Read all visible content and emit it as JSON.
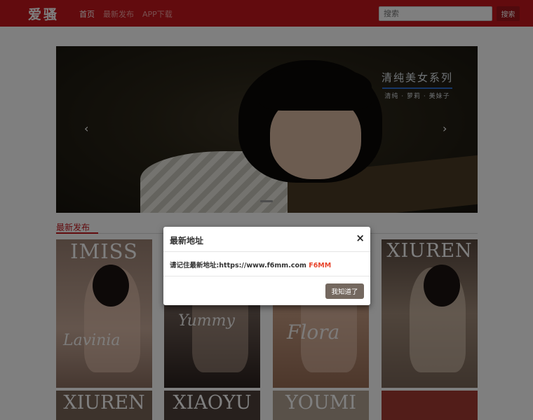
{
  "header": {
    "logo_text": "爱骚",
    "nav": [
      {
        "label": "首页"
      },
      {
        "label": "最新发布"
      },
      {
        "label": "APP下载"
      }
    ],
    "search": {
      "placeholder": "搜索",
      "button_label": "搜索"
    }
  },
  "carousel": {
    "caption_title": "清纯美女系列",
    "caption_sub": "清纯 · 萝莉 · 美妹子",
    "prev_icon": "chevron-left-icon",
    "next_icon": "chevron-right-icon"
  },
  "section": {
    "title": "最新发布"
  },
  "tiles": [
    {
      "brand": "IMISS",
      "script": "Lavinia",
      "bg": "#b19180"
    },
    {
      "brand": "",
      "script": "Yummy",
      "bg": "#6a5a52"
    },
    {
      "brand": "",
      "script": "Flora",
      "bg": "#c09278"
    },
    {
      "brand": "XIUREN",
      "script": "",
      "bg": "#8c7a6c"
    }
  ],
  "tiles_row2": [
    {
      "brand": "XIUREN",
      "bg": "#7a6658"
    },
    {
      "brand": "XIAOYU",
      "bg": "#5e4e46"
    },
    {
      "brand": "YOUMI",
      "bg": "#a89888"
    },
    {
      "brand": "",
      "bg": "#a53a32"
    }
  ],
  "modal": {
    "title": "最新地址",
    "close_label": "×",
    "text_prefix": "请记住最新地址:https://www.f6mm.com",
    "text_highlight": "F6MM",
    "ok_label": "我知道了"
  },
  "colors": {
    "brand_red": "#c4171d",
    "accent_orange": "#e8452c",
    "ok_button": "#74685f"
  }
}
